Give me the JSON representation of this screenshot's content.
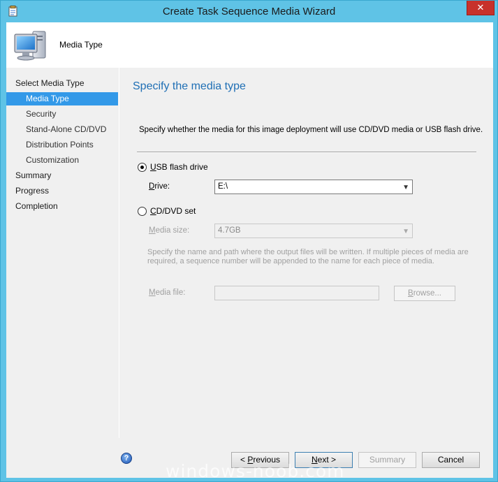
{
  "window": {
    "title": "Create Task Sequence Media Wizard",
    "close_glyph": "✕"
  },
  "header": {
    "title": "Media Type"
  },
  "nav": {
    "items": [
      {
        "label": "Select Media Type",
        "level": 0,
        "active": false
      },
      {
        "label": "Media Type",
        "level": 1,
        "active": true
      },
      {
        "label": "Security",
        "level": 1,
        "active": false
      },
      {
        "label": "Stand-Alone CD/DVD",
        "level": 1,
        "active": false
      },
      {
        "label": "Distribution Points",
        "level": 1,
        "active": false
      },
      {
        "label": "Customization",
        "level": 1,
        "active": false
      },
      {
        "label": "Summary",
        "level": 0,
        "active": false
      },
      {
        "label": "Progress",
        "level": 0,
        "active": false
      },
      {
        "label": "Completion",
        "level": 0,
        "active": false
      }
    ]
  },
  "main": {
    "title": "Specify the media type",
    "description": "Specify whether the media for this image deployment will use CD/DVD media or USB flash drive.",
    "usb": {
      "label_u": "U",
      "label_rest": "SB flash drive",
      "selected": true,
      "drive_label_u": "D",
      "drive_label_rest": "rive:",
      "drive_value": "E:\\"
    },
    "cddvd": {
      "label_u": "C",
      "label_rest": "D/DVD set",
      "selected": false,
      "size_label_u": "M",
      "size_label_rest": "edia size:",
      "size_value": "4.7GB",
      "note": "Specify the name and path where the output files will be written.  If multiple pieces of media are required, a sequence number will be appended to the name for each piece of media.",
      "file_label_u": "M",
      "file_label_rest": "edia file:",
      "file_value": "",
      "browse_label_u": "B",
      "browse_label_rest": "rowse..."
    }
  },
  "footer": {
    "help_glyph": "?",
    "previous_label_pre": "< ",
    "previous_label_u": "P",
    "previous_label_rest": "revious",
    "next_label_u": "N",
    "next_label_rest": "ext >",
    "summary_label": "Summary",
    "cancel_label": "Cancel"
  },
  "watermark": "windows-noob.com",
  "colors": {
    "frame": "#5fc3e6",
    "accent": "#3399e8",
    "title": "#1f6fb5",
    "close": "#c7312b"
  }
}
